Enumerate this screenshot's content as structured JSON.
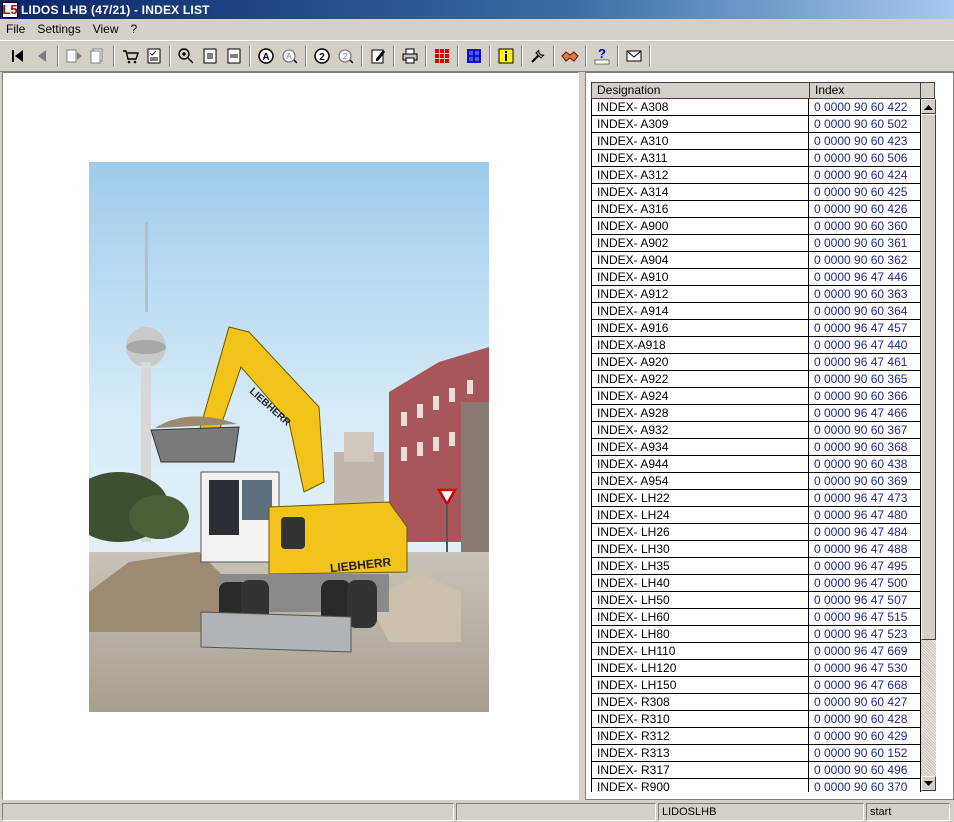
{
  "window": {
    "logo_text": "L5",
    "title": "LIDOS LHB (47/21) - INDEX LIST"
  },
  "menu": [
    "File",
    "Settings",
    "View",
    "?"
  ],
  "toolbar": {
    "icons": [
      "first-page-icon",
      "previous-page-icon",
      "next-doc-icon",
      "doc-list-icon",
      "cart-icon",
      "checklist-icon",
      "zoom-in-icon",
      "fit-page-icon",
      "fit-width-icon",
      "search-a-icon",
      "search-a-next-icon",
      "search-2-icon",
      "search-2-next-icon",
      "edit-note-icon",
      "print-icon",
      "grid-red-icon",
      "grid-blue-icon",
      "info-icon",
      "tools-icon",
      "handshake-icon",
      "lidos-help-icon",
      "mail-icon"
    ]
  },
  "photo": {
    "brand_arm": "LIEBHERR",
    "brand_body": "LIEBHERR",
    "sky_top": "#a8d4ef",
    "machine_yellow": "#f2c318"
  },
  "index_table": {
    "headers": [
      "Designation",
      "Index"
    ],
    "rows": [
      [
        "INDEX- A308",
        "0 0000 90 60 422"
      ],
      [
        "INDEX- A309",
        "0 0000 90 60 502"
      ],
      [
        "INDEX- A310",
        "0 0000 90 60 423"
      ],
      [
        "INDEX- A311",
        "0 0000 90 60 506"
      ],
      [
        "INDEX- A312",
        "0 0000 90 60 424"
      ],
      [
        "INDEX- A314",
        "0 0000 90 60 425"
      ],
      [
        "INDEX- A316",
        "0 0000 90 60 426"
      ],
      [
        "INDEX- A900",
        "0 0000 90 60 360"
      ],
      [
        "INDEX- A902",
        "0 0000 90 60 361"
      ],
      [
        "INDEX- A904",
        "0 0000 90 60 362"
      ],
      [
        "INDEX- A910",
        "0 0000 96 47 446"
      ],
      [
        "INDEX- A912",
        "0 0000 90 60 363"
      ],
      [
        "INDEX- A914",
        "0 0000 90 60 364"
      ],
      [
        "INDEX- A916",
        "0 0000 96 47 457"
      ],
      [
        "INDEX-A918",
        "0 0000 96 47 440"
      ],
      [
        "INDEX- A920",
        "0 0000 96 47 461"
      ],
      [
        "INDEX- A922",
        "0 0000 90 60 365"
      ],
      [
        "INDEX- A924",
        "0 0000 90 60 366"
      ],
      [
        "INDEX- A928",
        "0 0000 96 47 466"
      ],
      [
        "INDEX- A932",
        "0 0000 90 60 367"
      ],
      [
        "INDEX- A934",
        "0 0000 90 60 368"
      ],
      [
        "INDEX- A944",
        "0 0000 90 60 438"
      ],
      [
        "INDEX- A954",
        "0 0000 90 60 369"
      ],
      [
        "INDEX- LH22",
        "0 0000 96 47 473"
      ],
      [
        "INDEX- LH24",
        "0 0000 96 47 480"
      ],
      [
        "INDEX- LH26",
        "0 0000 96 47 484"
      ],
      [
        "INDEX- LH30",
        "0 0000 96 47 488"
      ],
      [
        "INDEX- LH35",
        "0 0000 96 47 495"
      ],
      [
        "INDEX- LH40",
        "0 0000 96 47 500"
      ],
      [
        "INDEX- LH50",
        "0 0000 96 47 507"
      ],
      [
        "INDEX- LH60",
        "0 0000 96 47 515"
      ],
      [
        "INDEX- LH80",
        "0 0000 96 47 523"
      ],
      [
        "INDEX- LH110",
        "0 0000 96 47 669"
      ],
      [
        "INDEX- LH120",
        "0 0000 96 47 530"
      ],
      [
        "INDEX- LH150",
        "0 0000 96 47 668"
      ],
      [
        "INDEX- R308",
        "0 0000 90 60 427"
      ],
      [
        "INDEX- R310",
        "0 0000 90 60 428"
      ],
      [
        "INDEX- R312",
        "0 0000 90 60 429"
      ],
      [
        "INDEX- R313",
        "0 0000 90 60 152"
      ],
      [
        "INDEX- R317",
        "0 0000 90 60 496"
      ],
      [
        "INDEX- R900",
        "0 0000 90 60 370"
      ]
    ]
  },
  "status": {
    "panel1": "",
    "panel2": "",
    "panel3": "LIDOSLHB",
    "panel4": "start"
  }
}
